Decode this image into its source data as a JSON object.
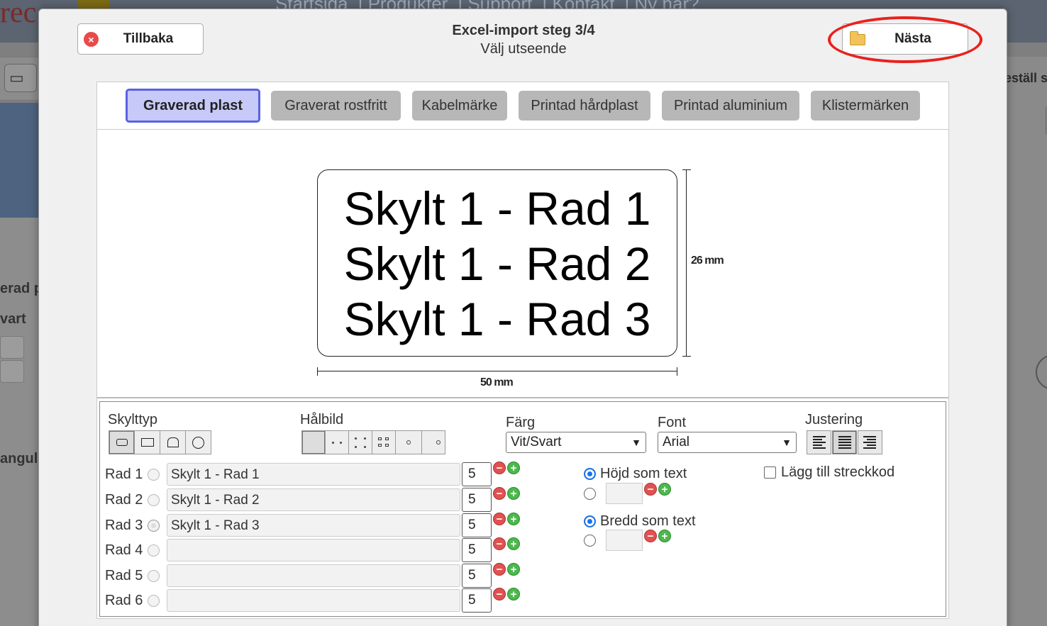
{
  "background": {
    "logo_text": "rec",
    "nav_items": [
      "Startsida",
      "Produkter",
      "Support",
      "Kontakt",
      "Ny här?"
    ],
    "left_labels": [
      "erad p",
      "vart",
      "angul"
    ],
    "right_label": "eställ s"
  },
  "header": {
    "title": "Excel-import steg 3/4",
    "subtitle": "Välj utseende",
    "back_label": "Tillbaka",
    "next_label": "Nästa"
  },
  "tabs": [
    {
      "label": "Graverad plast",
      "active": true
    },
    {
      "label": "Graverat rostfritt",
      "active": false
    },
    {
      "label": "Kabelmärke",
      "active": false
    },
    {
      "label": "Printad hårdplast",
      "active": false
    },
    {
      "label": "Printad aluminium",
      "active": false
    },
    {
      "label": "Klistermärken",
      "active": false
    }
  ],
  "preview": {
    "lines": [
      "Skylt 1 - Rad 1",
      "Skylt 1 - Rad 2",
      "Skylt 1 - Rad 3"
    ],
    "height_label": "26 mm",
    "width_label": "50 mm"
  },
  "settings": {
    "sign_type_label": "Skylttyp",
    "hole_label": "Hålbild",
    "color_label": "Färg",
    "color_value": "Vit/Svart",
    "font_label": "Font",
    "font_value": "Arial",
    "align_label": "Justering",
    "rows": [
      {
        "label": "Rad 1",
        "text": "Skylt 1 - Rad 1",
        "size": "5",
        "selected": false
      },
      {
        "label": "Rad 2",
        "text": "Skylt 1 - Rad 2",
        "size": "5",
        "selected": false
      },
      {
        "label": "Rad 3",
        "text": "Skylt 1 - Rad 3",
        "size": "5",
        "selected": true
      },
      {
        "label": "Rad 4",
        "text": "",
        "size": "5",
        "selected": false
      },
      {
        "label": "Rad 5",
        "text": "",
        "size": "5",
        "selected": false
      },
      {
        "label": "Rad 6",
        "text": "",
        "size": "5",
        "selected": false
      }
    ],
    "height_option": "Höjd som text",
    "width_option": "Bredd som text",
    "barcode_label": "Lägg till streckkod"
  },
  "colors": {
    "active_tab_bg": "#c7caf8",
    "active_tab_border": "#5b62e0",
    "highlight": "#e8221e"
  }
}
